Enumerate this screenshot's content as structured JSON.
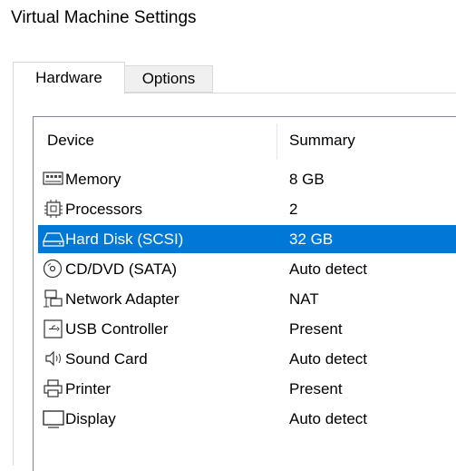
{
  "window": {
    "title": "Virtual Machine Settings"
  },
  "tabs": [
    {
      "label": "Hardware",
      "active": true
    },
    {
      "label": "Options",
      "active": false
    }
  ],
  "columns": {
    "device": "Device",
    "summary": "Summary"
  },
  "devices": [
    {
      "name": "Memory",
      "summary": "8 GB",
      "icon": "memory-icon"
    },
    {
      "name": "Processors",
      "summary": "2",
      "icon": "processor-icon"
    },
    {
      "name": "Hard Disk (SCSI)",
      "summary": "32 GB",
      "icon": "hard-disk-icon",
      "selected": true
    },
    {
      "name": "CD/DVD (SATA)",
      "summary": "Auto detect",
      "icon": "cd-dvd-icon"
    },
    {
      "name": "Network Adapter",
      "summary": "NAT",
      "icon": "network-adapter-icon"
    },
    {
      "name": "USB Controller",
      "summary": "Present",
      "icon": "usb-icon"
    },
    {
      "name": "Sound Card",
      "summary": "Auto detect",
      "icon": "speaker-icon"
    },
    {
      "name": "Printer",
      "summary": "Present",
      "icon": "printer-icon"
    },
    {
      "name": "Display",
      "summary": "Auto detect",
      "icon": "display-icon"
    }
  ],
  "colors": {
    "selection": "#0078d7",
    "border": "#828790"
  }
}
